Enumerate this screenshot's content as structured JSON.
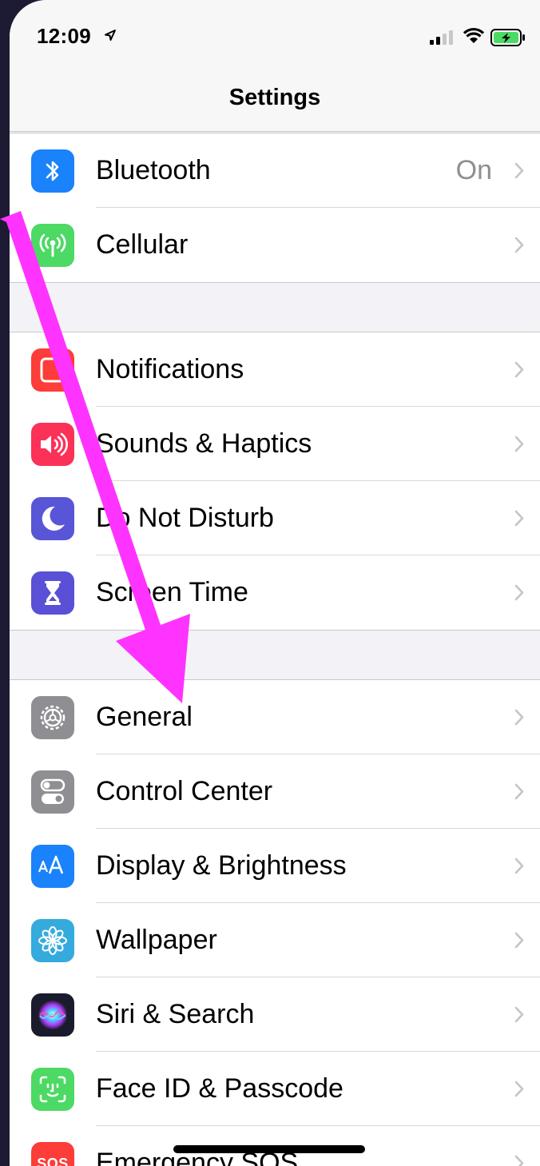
{
  "status_bar": {
    "time": "12:09"
  },
  "nav": {
    "title": "Settings"
  },
  "rows": {
    "bluetooth": {
      "label": "Bluetooth",
      "value": "On"
    },
    "cellular": {
      "label": "Cellular"
    },
    "notifications": {
      "label": "Notifications"
    },
    "sounds": {
      "label": "Sounds & Haptics"
    },
    "dnd": {
      "label": "Do Not Disturb"
    },
    "screen_time": {
      "label": "Screen Time"
    },
    "general": {
      "label": "General"
    },
    "control_center": {
      "label": "Control Center"
    },
    "display": {
      "label": "Display & Brightness"
    },
    "wallpaper": {
      "label": "Wallpaper"
    },
    "siri": {
      "label": "Siri & Search"
    },
    "faceid": {
      "label": "Face ID & Passcode"
    },
    "sos": {
      "label": "Emergency SOS",
      "icon_text": "SOS"
    }
  },
  "icons": {
    "bluetooth": "bluetooth-icon",
    "cellular": "cellular-icon",
    "notifications": "notifications-icon",
    "sounds": "speaker-icon",
    "dnd": "moon-icon",
    "screen_time": "hourglass-icon",
    "general": "gear-icon",
    "control_center": "toggles-icon",
    "display": "text-size-icon",
    "wallpaper": "flower-icon",
    "siri": "siri-icon",
    "faceid": "face-id-icon",
    "sos": "sos-icon"
  },
  "colors": {
    "bluetooth": "#1a82fb",
    "cellular": "#4cd964",
    "notifications": "#fc3d39",
    "sounds": "#fc3158",
    "dnd": "#5856d6",
    "screen_time": "#5a50d6",
    "general": "#8e8e93",
    "control_center": "#8e8e93",
    "display": "#1a82fb",
    "wallpaper": "#35aadc",
    "siri": "#1b1b2e",
    "faceid": "#4cd964",
    "sos": "#fc3d39",
    "annotation_arrow": "#ff33ff"
  }
}
